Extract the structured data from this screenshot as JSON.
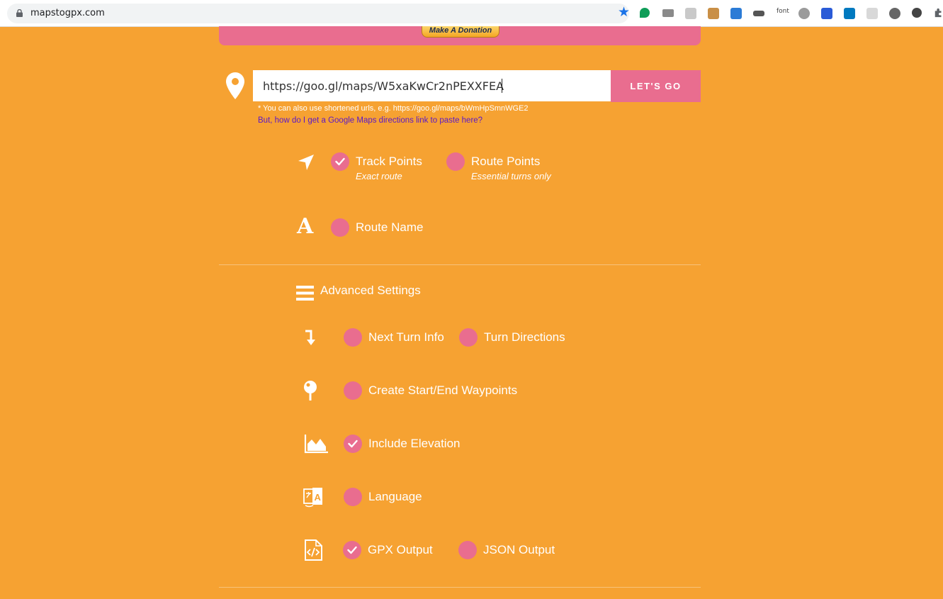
{
  "browser": {
    "url": "mapstogpx.com",
    "extension_font_label": "font"
  },
  "colors": {
    "background": "#f6a232",
    "accent": "#e96d8f",
    "link": "#5a17c9"
  },
  "donate": {
    "label": "Make A Donation"
  },
  "form": {
    "url_value": "https://goo.gl/maps/W5xaKwCr2nPEXXFEA",
    "go_label": "LET'S GO",
    "hint": "* You can also use shortened urls, e.g. https://goo.gl/maps/bWmHpSmnWGE2",
    "help_link": "But, how do I get a Google Maps directions link to paste here?"
  },
  "options": {
    "track_points": {
      "label": "Track Points",
      "sub": "Exact route",
      "checked": true
    },
    "route_points": {
      "label": "Route Points",
      "sub": "Essential turns only",
      "checked": false
    },
    "route_name": {
      "label": "Route Name",
      "checked": false
    }
  },
  "advanced": {
    "title": "Advanced Settings",
    "next_turn_info": {
      "label": "Next Turn Info",
      "checked": false
    },
    "turn_directions": {
      "label": "Turn Directions",
      "checked": false
    },
    "waypoints": {
      "label": "Create Start/End Waypoints",
      "checked": false
    },
    "elevation": {
      "label": "Include Elevation",
      "checked": true
    },
    "language": {
      "label": "Language",
      "checked": false
    },
    "gpx_output": {
      "label": "GPX Output",
      "checked": true
    },
    "json_output": {
      "label": "JSON Output",
      "checked": false
    }
  }
}
